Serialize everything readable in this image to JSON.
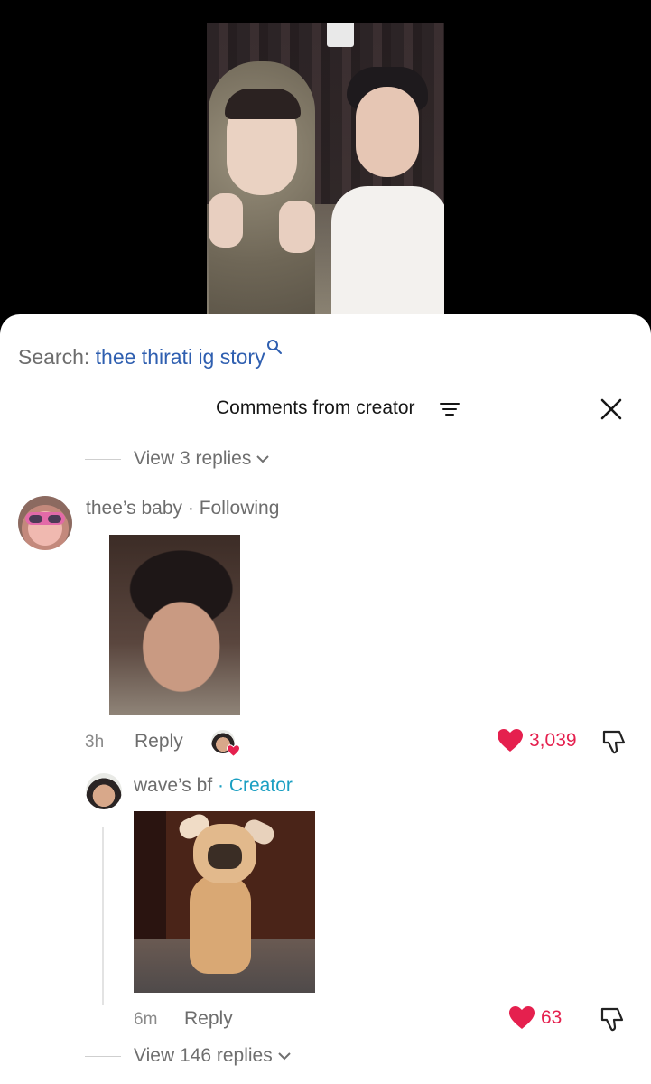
{
  "search": {
    "prefix": "Search:",
    "term": "thee thirati ig story"
  },
  "header": {
    "title": "Comments from creator"
  },
  "top_thread": {
    "view_replies_label": "View 3 replies"
  },
  "comment": {
    "username": "thee’s baby",
    "relation": "· Following",
    "time": "3h",
    "reply_label": "Reply",
    "likes": "3,039"
  },
  "reply": {
    "username": "wave’s bf",
    "relation": "· Creator",
    "time": "6m",
    "reply_label": "Reply",
    "likes": "63"
  },
  "bottom_thread": {
    "view_replies_label": "View 146 replies"
  },
  "colors": {
    "search_term": "#2f5fb0",
    "creator_tag": "#1b9fc2",
    "like_red": "#e5204e"
  }
}
